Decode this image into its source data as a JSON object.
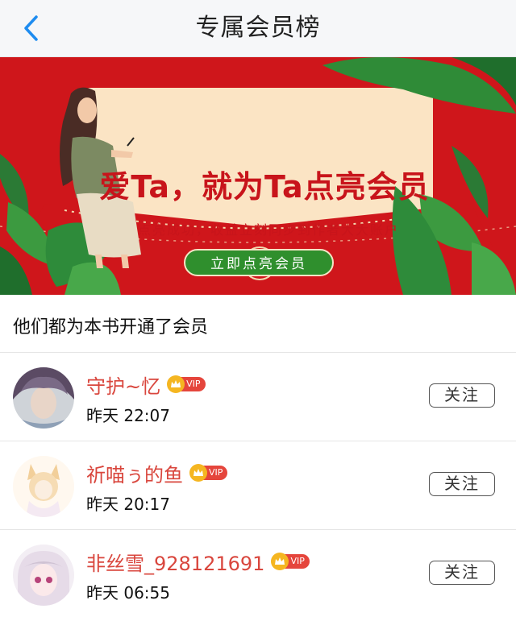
{
  "navbar": {
    "title": "专属会员榜",
    "back_icon": "chevron-left-icon"
  },
  "banner": {
    "title": "爱Ta，就为Ta点亮会员",
    "subtitle": "点亮成功，收益立刻同步到作者大大账户",
    "button_label": "立即点亮会员"
  },
  "section": {
    "title": "他们都为本书开通了会员"
  },
  "members": [
    {
      "name": "守护~忆",
      "vip_label": "VIP",
      "time": "昨天 22:07",
      "follow_label": "关注"
    },
    {
      "name": "祈喵ぅ的鱼",
      "vip_label": "VIP",
      "time": "昨天 20:17",
      "follow_label": "关注"
    },
    {
      "name": "非丝雪_928121691",
      "vip_label": "VIP",
      "time": "昨天 06:55",
      "follow_label": "关注"
    }
  ],
  "colors": {
    "accent_red": "#cf161b",
    "name_red": "#d9463d",
    "nav_blue": "#1e8cf0",
    "button_green": "#2f8f2d"
  }
}
